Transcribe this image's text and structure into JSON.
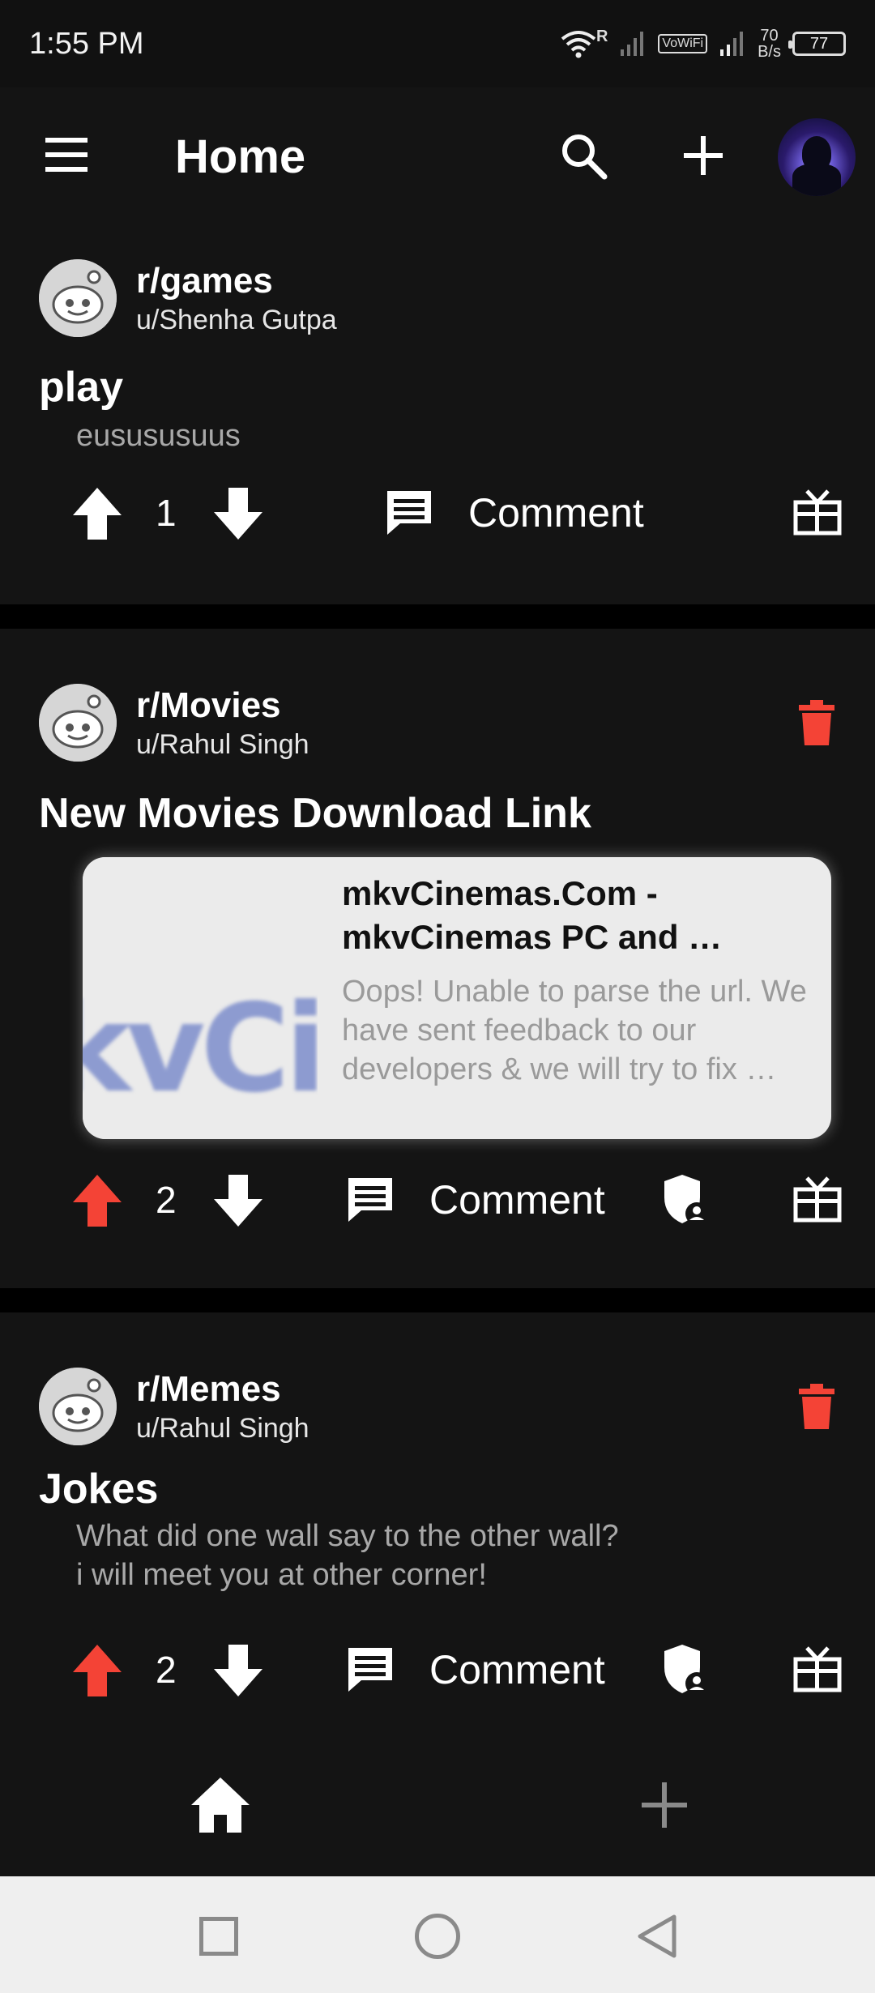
{
  "status_bar": {
    "time": "1:55 PM",
    "net_speed_value": "70",
    "net_speed_unit": "B/s",
    "vowifi": "VoWiFi",
    "battery": "77",
    "roaming": "R"
  },
  "app_bar": {
    "title": "Home"
  },
  "posts": [
    {
      "subreddit": "r/games",
      "user": "u/Shenha Gutpa",
      "title": "play",
      "body": "eusususuus",
      "score": "1",
      "comment_label": "Comment",
      "upvoted": false
    },
    {
      "subreddit": "r/Movies",
      "user": "u/Rahul Singh",
      "title": "New Movies Download Link",
      "link_title": "mkvCinemas.Com - mkvCinemas PC and …",
      "link_desc": "Oops! Unable to parse the url. We have sent feedback to our developers & we will try to fix …",
      "link_thumb_text": "kvCii",
      "score": "2",
      "comment_label": "Comment",
      "upvoted": true
    },
    {
      "subreddit": "r/Memes",
      "user": "u/Rahul Singh",
      "title": "Jokes",
      "body_line1": "What did one wall say to the other wall?",
      "body_line2": "i will meet you at other corner!",
      "score": "2",
      "comment_label": "Comment",
      "upvoted": true
    }
  ],
  "colors": {
    "upvote_active": "#f44336",
    "delete": "#f44336",
    "background": "#141414",
    "separator": "#000000"
  },
  "icons": [
    "menu-icon",
    "search-icon",
    "add-icon",
    "upvote-icon",
    "downvote-icon",
    "comment-icon",
    "gift-icon",
    "trash-icon",
    "shield-user-icon",
    "home-icon"
  ]
}
